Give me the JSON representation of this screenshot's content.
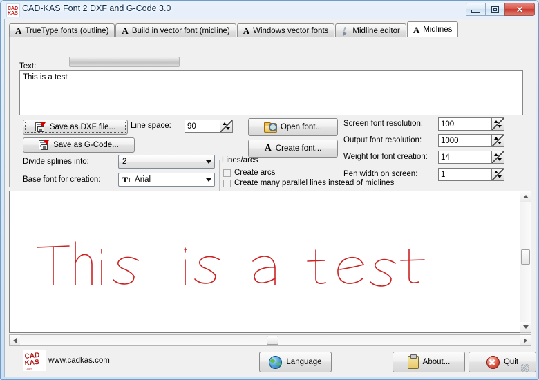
{
  "window": {
    "title": "CAD-KAS Font 2 DXF and G-Code 3.0",
    "icon": "cadkas-logo-icon",
    "minimize_label": "",
    "maximize_label": "",
    "close_label": "✕"
  },
  "tabs": [
    {
      "label": "TrueType fonts (outline)",
      "icon": "letter-a-icon",
      "active": false
    },
    {
      "label": "Build in vector font (midline)",
      "icon": "letter-a-icon",
      "active": false
    },
    {
      "label": "Windows vector fonts",
      "icon": "letter-a-icon",
      "active": false
    },
    {
      "label": "Midline editor",
      "icon": "pen-icon",
      "active": false
    },
    {
      "label": "Midlines",
      "icon": "letter-a-icon",
      "active": true
    }
  ],
  "panel": {
    "text_label": "Text:",
    "progress_value": "",
    "text_value": "This is a test",
    "save_dxf_label": "Save as DXF file...",
    "save_gcode_label": "Save as G-Code...",
    "open_font_label": "Open font...",
    "create_font_label": "Create font...",
    "line_space_label": "Line space:",
    "line_space_value": "90",
    "divide_splines_label": "Divide splines into:",
    "divide_splines_value": "2",
    "base_font_label": "Base font for creation:",
    "base_font_value": "Arial",
    "lines_arcs_group": "Lines/arcs",
    "create_arcs_label": "Create arcs",
    "create_arcs_checked": false,
    "create_parallel_label": "Create many parallel lines instead of midlines",
    "create_parallel_checked": false,
    "screen_font_resolution_label": "Screen font resolution:",
    "screen_font_resolution_value": "100",
    "output_font_resolution_label": "Output font resolution:",
    "output_font_resolution_value": "1000",
    "weight_label": "Weight for font creation:",
    "weight_value": "14",
    "pen_width_label": "Pen width on screen:",
    "pen_width_value": "1"
  },
  "canvas": {
    "preview_text": "This is a test",
    "stroke_color": "#cc2222",
    "background": "#ffffff"
  },
  "footer": {
    "website": "www.cadkas.com",
    "language_label": "Language",
    "about_label": "About...",
    "quit_label": "Quit"
  }
}
